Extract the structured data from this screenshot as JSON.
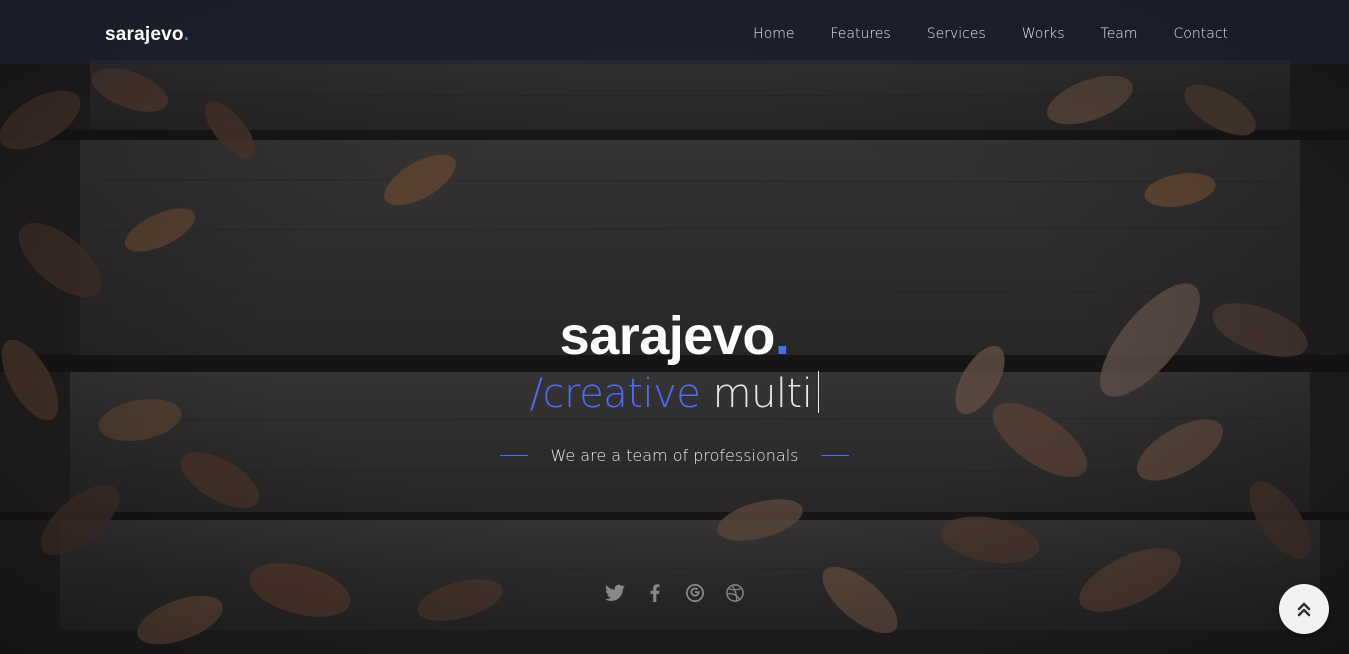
{
  "brand": {
    "name": "sarajevo",
    "dot": "."
  },
  "nav": {
    "items": [
      "Home",
      "Features",
      "Services",
      "Works",
      "Team",
      "Contact"
    ]
  },
  "hero": {
    "title": "sarajevo",
    "title_dot": ".",
    "typed_accent": "/creative",
    "typed_text": "multi",
    "tagline": "We are a team of professionals"
  },
  "social": [
    "twitter-icon",
    "facebook-icon",
    "google-plus-icon",
    "dribbble-icon"
  ],
  "colors": {
    "accent": "#4a6cf7",
    "nav_bg": "#1e2237"
  }
}
